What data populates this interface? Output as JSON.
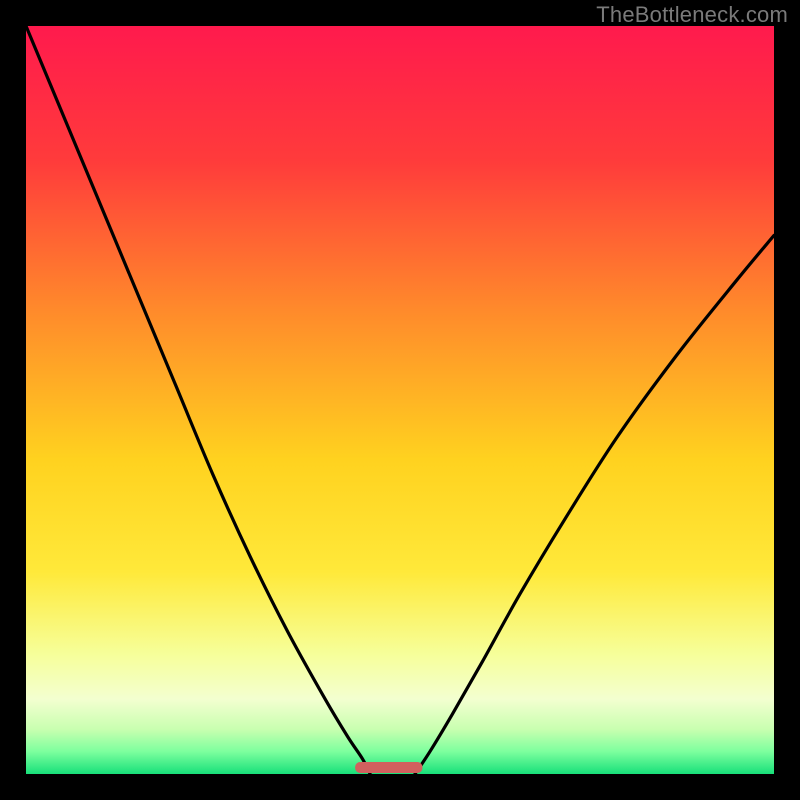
{
  "watermark": "TheBottleneck.com",
  "chart_data": {
    "type": "line",
    "title": "",
    "xlabel": "",
    "ylabel": "",
    "xlim": [
      0,
      100
    ],
    "ylim": [
      0,
      100
    ],
    "gradient_stops": [
      {
        "offset": 0,
        "color": "#ff1a4d"
      },
      {
        "offset": 18,
        "color": "#ff3b3b"
      },
      {
        "offset": 38,
        "color": "#ff8a2b"
      },
      {
        "offset": 58,
        "color": "#ffd21f"
      },
      {
        "offset": 73,
        "color": "#ffe93a"
      },
      {
        "offset": 84,
        "color": "#f6ff9a"
      },
      {
        "offset": 90,
        "color": "#f3ffd0"
      },
      {
        "offset": 94,
        "color": "#c9ffb0"
      },
      {
        "offset": 97,
        "color": "#7dff9e"
      },
      {
        "offset": 100,
        "color": "#18e07a"
      }
    ],
    "series": [
      {
        "name": "left-arc",
        "x": [
          0,
          5,
          10,
          15,
          20,
          25,
          30,
          35,
          40,
          43,
          45,
          46
        ],
        "y": [
          100,
          88,
          76,
          64,
          52,
          40,
          29,
          19,
          10,
          5,
          2,
          0
        ]
      },
      {
        "name": "right-arc",
        "x": [
          52,
          54,
          57,
          61,
          66,
          72,
          79,
          87,
          95,
          100
        ],
        "y": [
          0,
          3,
          8,
          15,
          24,
          34,
          45,
          56,
          66,
          72
        ]
      }
    ],
    "marker": {
      "name": "bottom-bar",
      "x_start": 44,
      "x_end": 53,
      "y": 0.5,
      "color": "#d1605e"
    }
  }
}
